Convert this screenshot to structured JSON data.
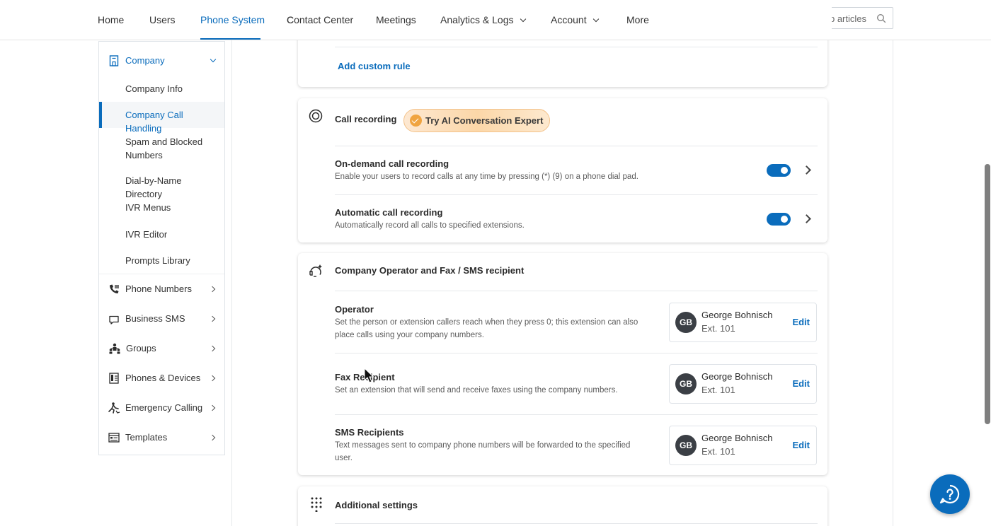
{
  "topnav": {
    "items": [
      {
        "label": "Home"
      },
      {
        "label": "Users"
      },
      {
        "label": "Phone System"
      },
      {
        "label": "Contact Center"
      },
      {
        "label": "Meetings"
      },
      {
        "label": "Analytics & Logs"
      },
      {
        "label": "Account"
      },
      {
        "label": "More"
      }
    ],
    "active": "Phone System",
    "search_placeholder": "Search settings, pages, or help articles"
  },
  "sidebar": {
    "section": "Company",
    "subitems": [
      {
        "label": "Company Info"
      },
      {
        "label": "Company Call Handling"
      },
      {
        "label": "Spam and Blocked Numbers"
      },
      {
        "label": "Dial-by-Name Directory"
      },
      {
        "label": "IVR Menus"
      },
      {
        "label": "IVR Editor"
      },
      {
        "label": "Prompts Library"
      }
    ],
    "active_subitem": "Company Call Handling",
    "items": [
      {
        "label": "Phone Numbers",
        "icon": "phone-icon"
      },
      {
        "label": "Business SMS",
        "icon": "chat-bubble-icon"
      },
      {
        "label": "Groups",
        "icon": "groups-icon"
      },
      {
        "label": "Phones & Devices",
        "icon": "device-icon"
      },
      {
        "label": "Emergency Calling",
        "icon": "emergency-icon"
      },
      {
        "label": "Templates",
        "icon": "templates-icon"
      }
    ]
  },
  "custom_rules": {
    "add_label": "Add custom rule"
  },
  "call_recording": {
    "title": "Call recording",
    "ai_badge": "Try AI Conversation Expert",
    "rows": [
      {
        "title": "On-demand call recording",
        "desc": "Enable your users to record calls at any time by pressing (*) (9) on a phone dial pad.",
        "enabled": true
      },
      {
        "title": "Automatic call recording",
        "desc": "Automatically record all calls to specified extensions.",
        "enabled": true
      }
    ]
  },
  "operator": {
    "title": "Company Operator and Fax / SMS recipient",
    "rows": [
      {
        "title": "Operator",
        "desc": "Set the person or extension callers reach when they press 0; this extension can also place calls using your company numbers.",
        "initials": "GB",
        "name": "George Bohnisch",
        "ext": "Ext. 101",
        "edit": "Edit"
      },
      {
        "title": "Fax Recipient",
        "desc": "Set an extension that will send and receive faxes using the company numbers.",
        "initials": "GB",
        "name": "George Bohnisch",
        "ext": "Ext. 101",
        "edit": "Edit"
      },
      {
        "title": "SMS Recipients",
        "desc": "Text messages sent to company phone numbers will be forwarded to the specified user.",
        "initials": "GB",
        "name": "George Bohnisch",
        "ext": "Ext. 101",
        "edit": "Edit"
      }
    ]
  },
  "additional": {
    "title": "Additional settings"
  },
  "colors": {
    "accent": "#0a6cbc",
    "ai_badge": "#f0a441"
  }
}
